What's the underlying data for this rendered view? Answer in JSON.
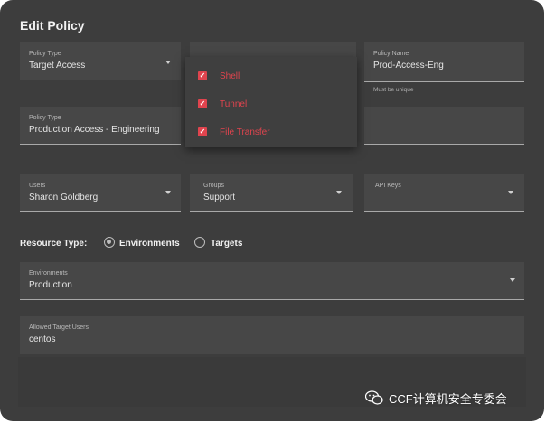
{
  "dialog": {
    "title": "Edit Policy"
  },
  "fields": {
    "policy_type": {
      "label": "Policy Type",
      "value": "Target Access"
    },
    "policy_name": {
      "label": "Policy Name",
      "value": "Prod-Access-Eng",
      "hint": "Must be unique"
    },
    "policy_type2": {
      "label": "Policy Type",
      "value": "Production Access - Engineering"
    },
    "users": {
      "label": "Users",
      "value": "Sharon Goldberg"
    },
    "groups": {
      "label": "Groups",
      "value": "Support"
    },
    "api_keys": {
      "label": "API Keys",
      "value": ""
    },
    "environments": {
      "label": "Environments",
      "value": "Production"
    },
    "allowed_target_users": {
      "label": "Allowed Target Users",
      "value": "centos"
    }
  },
  "access_menu": {
    "options": [
      {
        "label": "Shell",
        "checked": true
      },
      {
        "label": "Tunnel",
        "checked": true
      },
      {
        "label": "File Transfer",
        "checked": true
      }
    ]
  },
  "resource_type": {
    "label": "Resource Type:",
    "options": [
      {
        "label": "Environments",
        "selected": true
      },
      {
        "label": "Targets",
        "selected": false
      }
    ]
  },
  "watermark": {
    "text": "CCF计算机安全专委会",
    "icon": "wechat-icon"
  },
  "colors": {
    "dialog_bg": "#3d3d3d",
    "field_bg": "#474747",
    "accent": "#e0444e"
  }
}
